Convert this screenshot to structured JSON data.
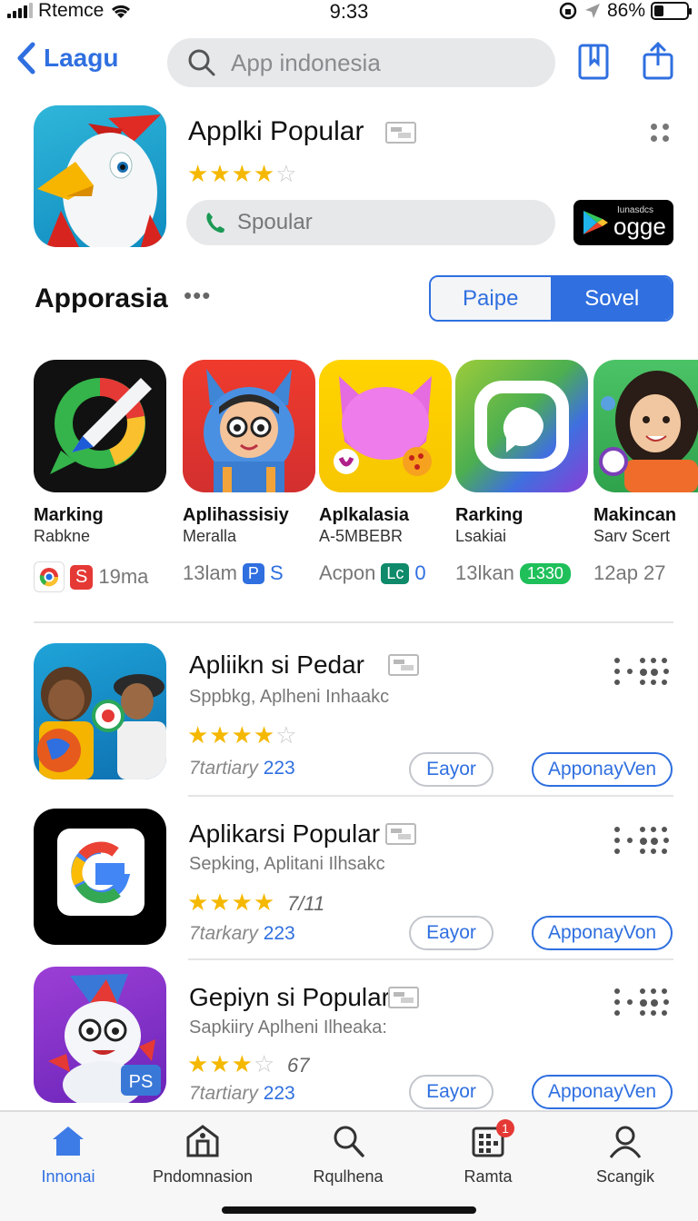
{
  "status_bar": {
    "carrier": "Rtemce",
    "time": "9:33",
    "battery": "86%"
  },
  "nav": {
    "back_label": "Laagu",
    "search_placeholder": "App indonesia"
  },
  "featured": {
    "title": "Applki Popular",
    "rating": 4,
    "input_placeholder": "Spoular",
    "store_badge_small": "Iunasdcs",
    "store_badge_big": "ogge"
  },
  "section": {
    "title": "Apporasia",
    "more": "•••",
    "segments": [
      "Paipe",
      "Sovel"
    ],
    "selected_segment": "Sovel"
  },
  "carousel": [
    {
      "name": "Marking",
      "sub": "Rabkne",
      "meta": "19ma",
      "badge": "S"
    },
    {
      "name": "Aplihassisiy",
      "sub": "Meralla",
      "meta": "13lam",
      "badge": "P",
      "badge2": "S"
    },
    {
      "name": "Aplkalasia",
      "sub": "A​-5MBEBR",
      "meta": "Acpon",
      "badge": "Lc",
      "badge2": "0"
    },
    {
      "name": "Rarking",
      "sub": "Lsakiai",
      "meta": "13lkan",
      "badge": "1330"
    },
    {
      "name": "Makincan",
      "sub": "Sarv Scert",
      "meta": "12ap 27"
    }
  ],
  "list": [
    {
      "title": "Apliikn si Pedar",
      "subtitle": "Sppbkg, Aplheni Inhaakc",
      "rating": 4,
      "rating_text": "",
      "date_label": "7tartiary",
      "date_num": "223",
      "secondary_button": "Eayor",
      "primary_button": "ApponayVen"
    },
    {
      "title": "Aplikarsi Popular",
      "subtitle": "Sepking, Aplitani Ilhsakc",
      "rating": 4,
      "rating_text": "7/11",
      "date_label": "7tarkary",
      "date_num": "223",
      "secondary_button": "Eayor",
      "primary_button": "ApponayVon"
    },
    {
      "title": "Gepiyn si Popular",
      "subtitle": "Sapkiiry Aplheni Ilheaka:",
      "rating": 3,
      "rating_text": "67",
      "date_label": "7tartiary",
      "date_num": "223",
      "secondary_button": "Eayor",
      "primary_button": "ApponayVen"
    }
  ],
  "tabbar": [
    {
      "label": "Innonai",
      "icon": "home-icon",
      "active": true
    },
    {
      "label": "Pndomnasion",
      "icon": "store-icon",
      "active": false
    },
    {
      "label": "Rqulhena",
      "icon": "search-icon",
      "active": false
    },
    {
      "label": "Ramta",
      "icon": "apps-icon",
      "active": false,
      "badge": "1"
    },
    {
      "label": "Scangik",
      "icon": "profile-icon",
      "active": false
    }
  ],
  "colors": {
    "accent": "#2f6fe0",
    "star": "#f5b800",
    "badge_red": "#e53935",
    "badge_green": "#1fbf5a"
  }
}
